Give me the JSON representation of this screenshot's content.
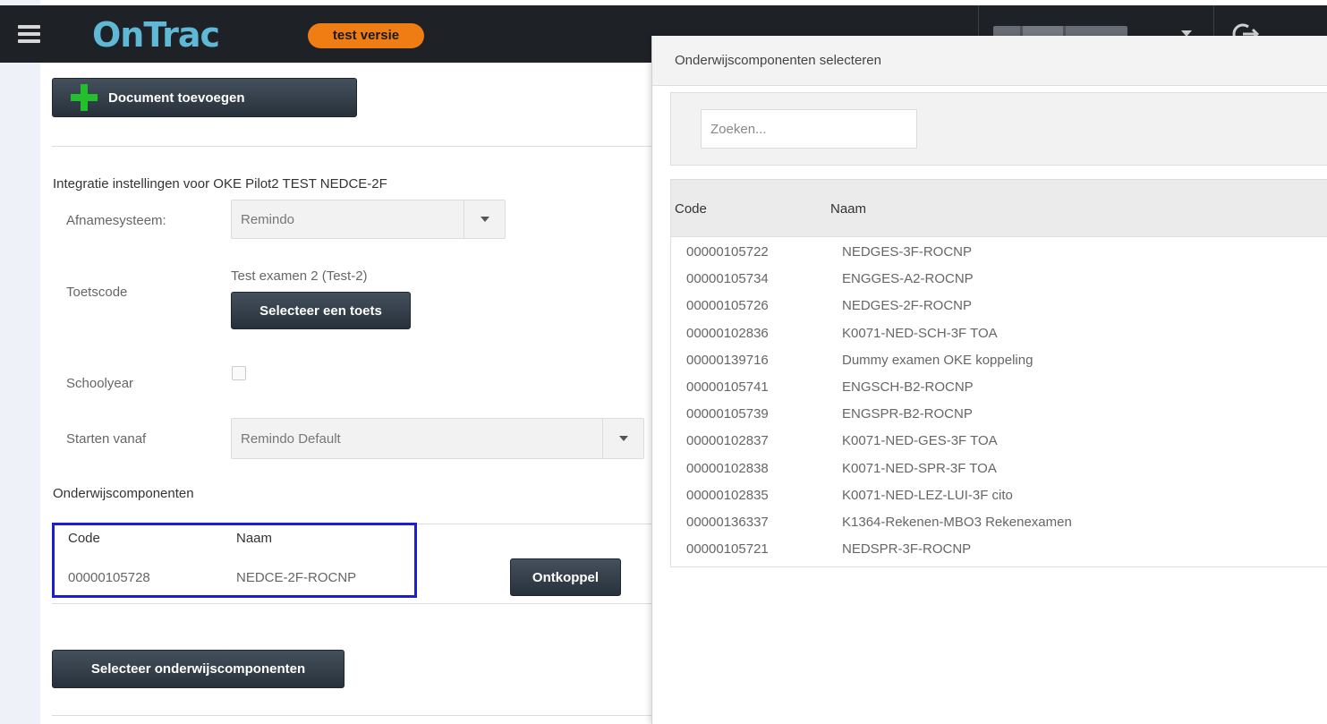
{
  "header": {
    "logo": "OnTrac",
    "badge": "test versie"
  },
  "main": {
    "add_document_label": "Document toevoegen",
    "integration_heading": "Integratie instellingen voor OKE Pilot2 TEST NEDCE-2F",
    "afnamesysteem_label": "Afnamesysteem:",
    "afnamesysteem_value": "Remindo",
    "toetscode_label": "Toetscode",
    "toetscode_value": "Test examen 2 (Test-2)",
    "select_test_label": "Selecteer een toets",
    "schoolyear_label": "Schoolyear",
    "starten_label": "Starten vanaf",
    "starten_value": "Remindo Default",
    "components_heading": "Onderwijscomponenten",
    "table": {
      "col_code": "Code",
      "col_naam": "Naam",
      "rows": [
        {
          "code": "00000105728",
          "naam": "NEDCE-2F-ROCNP"
        }
      ]
    },
    "unlink_label": "Ontkoppel",
    "select_components_label": "Selecteer onderwijscomponenten"
  },
  "modal": {
    "title": "Onderwijscomponenten selecteren",
    "search_placeholder": "Zoeken...",
    "col_code": "Code",
    "col_naam": "Naam",
    "rows": [
      {
        "code": "00000105722",
        "naam": "NEDGES-3F-ROCNP"
      },
      {
        "code": "00000105734",
        "naam": "ENGGES-A2-ROCNP"
      },
      {
        "code": "00000105726",
        "naam": "NEDGES-2F-ROCNP"
      },
      {
        "code": "00000102836",
        "naam": "K0071-NED-SCH-3F TOA"
      },
      {
        "code": "00000139716",
        "naam": "Dummy examen OKE koppeling"
      },
      {
        "code": "00000105741",
        "naam": "ENGSCH-B2-ROCNP"
      },
      {
        "code": "00000105739",
        "naam": "ENGSPR-B2-ROCNP"
      },
      {
        "code": "00000102837",
        "naam": "K0071-NED-GES-3F TOA"
      },
      {
        "code": "00000102838",
        "naam": "K0071-NED-SPR-3F TOA"
      },
      {
        "code": "00000102835",
        "naam": "K0071-NED-LEZ-LUI-3F cito"
      },
      {
        "code": "00000136337",
        "naam": "K1364-Rekenen-MBO3 Rekenexamen"
      },
      {
        "code": "00000105721",
        "naam": "NEDSPR-3F-ROCNP"
      }
    ]
  },
  "colors": {
    "topbar": "#1e2126",
    "logo": "#5fb8d6",
    "badge": "#f07c14",
    "button": "#2f3b47",
    "highlight": "#1a1fd0"
  },
  "icons": [
    "menu-icon",
    "plus-icon",
    "chevron-down-icon",
    "sign-out-icon"
  ]
}
